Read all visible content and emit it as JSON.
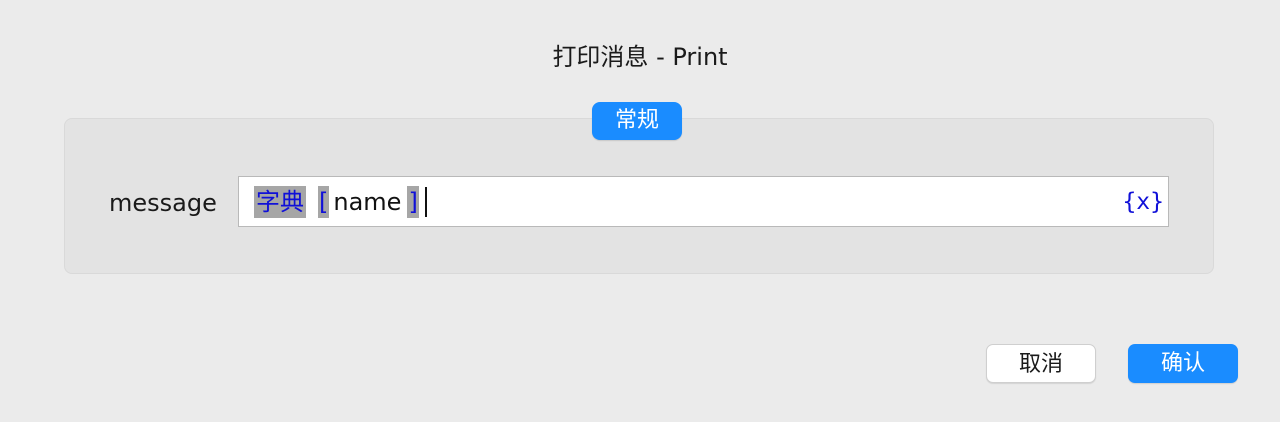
{
  "dialog": {
    "title": "打印消息 - Print"
  },
  "group": {
    "tab_label": "常规"
  },
  "field": {
    "label": "message",
    "tokens": {
      "dict": "字典",
      "open_bracket": "[",
      "name": "name",
      "close_bracket": "]"
    },
    "variable_button": "{x}"
  },
  "buttons": {
    "cancel": "取消",
    "confirm": "确认"
  },
  "colors": {
    "accent": "#1a8cff",
    "token_text": "#1010d8",
    "token_highlight": "#a6a6a6"
  }
}
